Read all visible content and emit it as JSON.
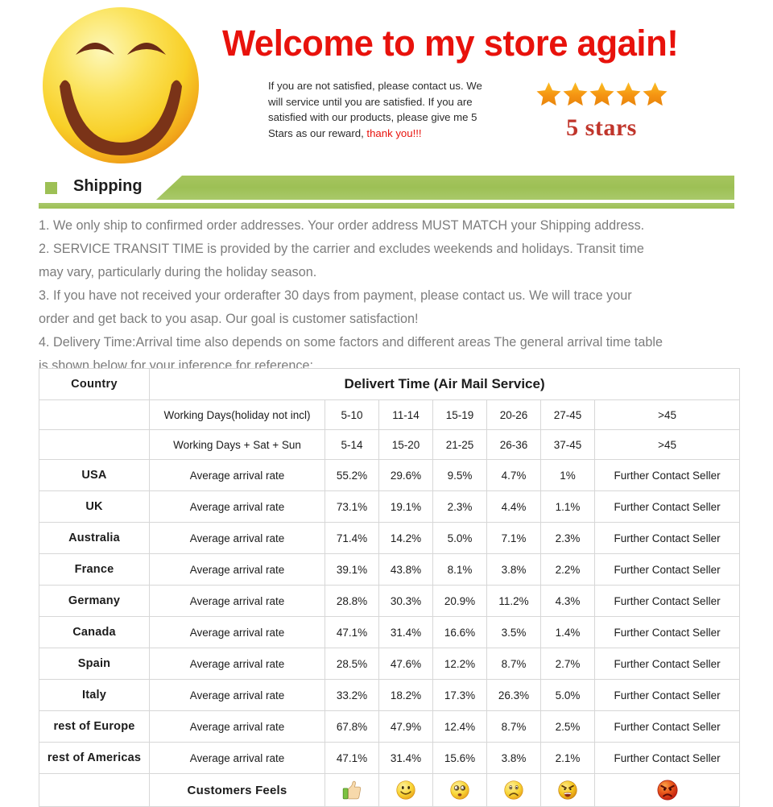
{
  "header": {
    "headline": "Welcome to my store again!",
    "paragraph_lines": [
      "If you are not satisfied, please contact us. We",
      "will service until you are satisfied. If you are",
      "satisfied with our products, please give me 5",
      "Stars as our reward, "
    ],
    "thanks_text": "thank you!!!",
    "stars_label": "5 stars",
    "star_count": 5,
    "smiley_icon": "smiley-face-icon",
    "colors": {
      "headline_red": "#e8120c",
      "stars_gold": "#f6a01a",
      "stars_label_red": "#c0352b"
    }
  },
  "banner": {
    "title": "Shipping",
    "square_icon": "green-square-icon",
    "color": "#9dc055"
  },
  "policy": {
    "lines": [
      "1. We only ship to confirmed order addresses. Your order address MUST MATCH your Shipping address.",
      "2. SERVICE TRANSIT TIME is provided by the carrier and excludes weekends and holidays. Transit time",
      "may vary, particularly during the holiday season.",
      "3. If you have not received your orderafter 30 days from payment, please contact us. We will trace your",
      "order and get back to you asap. Our goal is customer satisfaction!",
      "4. Delivery Time:Arrival time also depends on some factors and different areas The general arrival time table",
      "is shown below for your inference for reference:"
    ],
    "text_color": "#7c7c7c"
  },
  "table": {
    "head": {
      "country": "Country",
      "delivery": "Delivert Time (Air Mail Service)"
    },
    "days_rows": [
      {
        "label": "Working Days(holiday not incl)",
        "values": [
          "5-10",
          "11-14",
          "15-19",
          "20-26",
          "27-45"
        ],
        "last": ">45"
      },
      {
        "label": "Working Days + Sat + Sun",
        "values": [
          "5-14",
          "15-20",
          "21-25",
          "26-36",
          "37-45"
        ],
        "last": ">45"
      }
    ],
    "rate_label": "Average arrival rate",
    "further_label": "Further Contact Seller",
    "rows": [
      {
        "country": "USA",
        "values": [
          "55.2%",
          "29.6%",
          "9.5%",
          "4.7%",
          "1%"
        ]
      },
      {
        "country": "UK",
        "values": [
          "73.1%",
          "19.1%",
          "2.3%",
          "4.4%",
          "1.1%"
        ]
      },
      {
        "country": "Australia",
        "values": [
          "71.4%",
          "14.2%",
          "5.0%",
          "7.1%",
          "2.3%"
        ]
      },
      {
        "country": "France",
        "values": [
          "39.1%",
          "43.8%",
          "8.1%",
          "3.8%",
          "2.2%"
        ]
      },
      {
        "country": "Germany",
        "values": [
          "28.8%",
          "30.3%",
          "20.9%",
          "11.2%",
          "4.3%"
        ]
      },
      {
        "country": "Canada",
        "values": [
          "47.1%",
          "31.4%",
          "16.6%",
          "3.5%",
          "1.4%"
        ]
      },
      {
        "country": "Spain",
        "values": [
          "28.5%",
          "47.6%",
          "12.2%",
          "8.7%",
          "2.7%"
        ]
      },
      {
        "country": "Italy",
        "values": [
          "33.2%",
          "18.2%",
          "17.3%",
          "26.3%",
          "5.0%"
        ]
      },
      {
        "country": "rest of Europe",
        "values": [
          "67.8%",
          "47.9%",
          "12.4%",
          "8.7%",
          "2.5%"
        ]
      },
      {
        "country": "rest of Americas",
        "values": [
          "47.1%",
          "31.4%",
          "15.6%",
          "3.8%",
          "2.1%"
        ]
      }
    ],
    "feels": {
      "label": "Customers Feels",
      "icons": [
        "thumbs-up-icon",
        "smiling-face-icon",
        "dizzy-face-icon",
        "sad-face-icon",
        "angry-yelling-face-icon",
        "red-angry-face-icon"
      ]
    }
  }
}
